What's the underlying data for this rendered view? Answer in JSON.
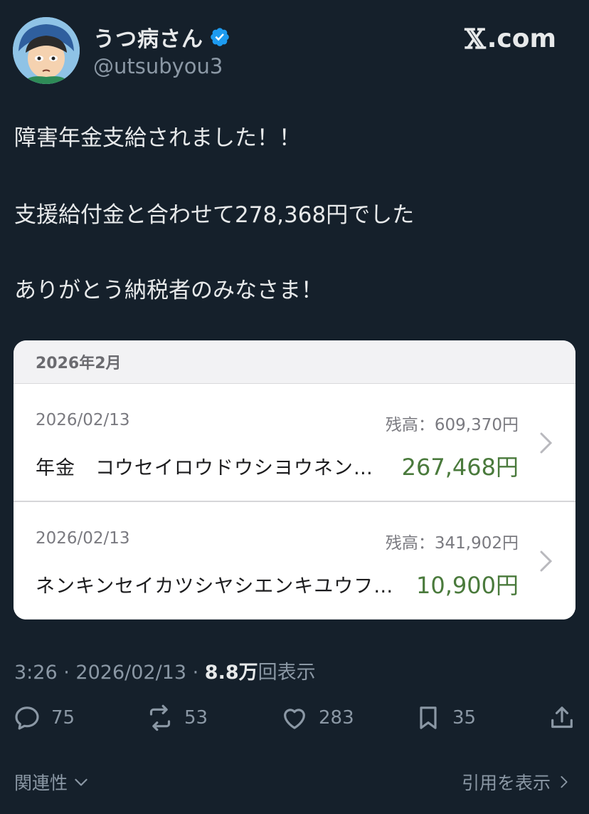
{
  "author": {
    "display_name": "うつ病さん",
    "handle": "@utsubyou3",
    "verified": true
  },
  "brand": {
    "site": "X.com",
    "mark": "𝕏",
    "suffix": ".com"
  },
  "tweet": {
    "lines": [
      "障害年金支給されました！！",
      "支援給付金と合わせて278,368円でした",
      "ありがとう納税者のみなさま！"
    ]
  },
  "bank_card": {
    "month_header": "2026年2月",
    "transactions": [
      {
        "date": "2026/02/13",
        "balance": "残高：609,370円",
        "description": "年金　コウセイロウドウシヨウネン…",
        "amount": "267,468円"
      },
      {
        "date": "2026/02/13",
        "balance": "残高：341,902円",
        "description": "ネンキンセイカツシヤシエンキユウフ…",
        "amount": "10,900円"
      }
    ]
  },
  "meta": {
    "time": "3:26",
    "date": "2026/02/13",
    "views_count": "8.8万",
    "views_label": "回表示"
  },
  "actions": {
    "replies": "75",
    "reposts": "53",
    "likes": "283",
    "bookmarks": "35"
  },
  "footer": {
    "related": "関連性",
    "quotes": "引用を表示"
  },
  "colors": {
    "background": "#15202b",
    "verified": "#1d9bf0",
    "amount_green": "#4a7a3c"
  }
}
